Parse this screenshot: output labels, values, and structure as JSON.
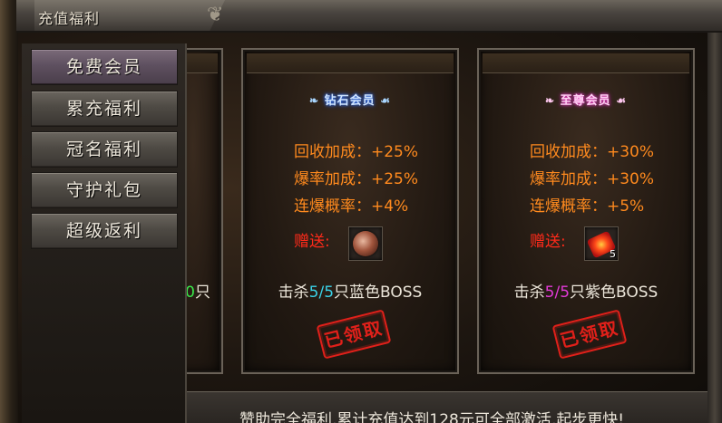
{
  "window": {
    "title": "充值福利"
  },
  "menu": {
    "items": [
      {
        "label": "免费会员",
        "active": true
      },
      {
        "label": "累充福利",
        "active": false
      },
      {
        "label": "冠名福利",
        "active": false
      },
      {
        "label": "守护礼包",
        "active": false
      },
      {
        "label": "超级返利",
        "active": false
      }
    ]
  },
  "partial_card": {
    "kill_count": "0",
    "kill_suffix": "只"
  },
  "cards": [
    {
      "title": "钻石会员",
      "stats": [
        {
          "label": "回收加成：",
          "value": "+25%"
        },
        {
          "label": "爆率加成：",
          "value": "+25%"
        },
        {
          "label": "连爆概率：",
          "value": "+4%"
        }
      ],
      "gift_label": "赠送:",
      "gift_icon": "orb-icon",
      "gift_count": "",
      "kill_prefix": "击杀",
      "kill_progress": "5/5",
      "kill_suffix": "只蓝色BOSS",
      "status": "已领取"
    },
    {
      "title": "至尊会员",
      "stats": [
        {
          "label": "回收加成：",
          "value": "+30%"
        },
        {
          "label": "爆率加成：",
          "value": "+30%"
        },
        {
          "label": "连爆概率：",
          "value": "+5%"
        }
      ],
      "gift_label": "赠送:",
      "gift_icon": "red-scroll-icon",
      "gift_count": "5",
      "kill_prefix": "击杀",
      "kill_progress": "5/5",
      "kill_suffix": "只紫色BOSS",
      "status": "已领取"
    }
  ],
  "footer": {
    "text": "赞助完全福利,累计充值达到128元可全部激活,起步更快!"
  },
  "colors": {
    "stat_orange": "#ff8a1e",
    "gift_red": "#ff2a1a",
    "progress_blue": "#3ad2e8",
    "progress_purple": "#e23ad8",
    "stamp_red": "#e0201a"
  }
}
